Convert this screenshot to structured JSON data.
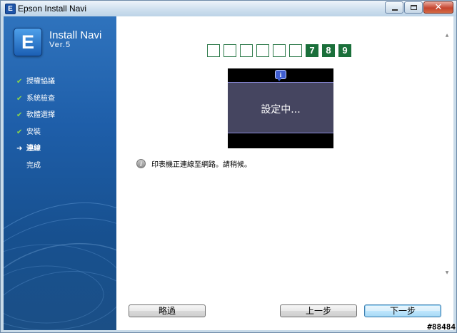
{
  "window": {
    "title": "Epson Install Navi",
    "close_glyph": "✕"
  },
  "sidebar": {
    "logo_letter": "E",
    "app_name": "Install Navi",
    "app_version": "Ver.5",
    "steps": [
      {
        "label": "授權協議",
        "state": "done",
        "marker": "✔"
      },
      {
        "label": "系統檢查",
        "state": "done",
        "marker": "✔"
      },
      {
        "label": "軟體選擇",
        "state": "done",
        "marker": "✔"
      },
      {
        "label": "安裝",
        "state": "done",
        "marker": "✔"
      },
      {
        "label": "連線",
        "state": "current",
        "marker": "➜"
      },
      {
        "label": "完成",
        "state": "pending",
        "marker": ""
      }
    ]
  },
  "progress": {
    "boxes": [
      {
        "label": "",
        "on": false
      },
      {
        "label": "",
        "on": false
      },
      {
        "label": "",
        "on": false
      },
      {
        "label": "",
        "on": false
      },
      {
        "label": "",
        "on": false
      },
      {
        "label": "",
        "on": false
      },
      {
        "label": "7",
        "on": true
      },
      {
        "label": "8",
        "on": true
      },
      {
        "label": "9",
        "on": true
      }
    ]
  },
  "lcd": {
    "info_glyph": "i",
    "text": "設定中..."
  },
  "status": {
    "icon_glyph": "i",
    "message": "印表機正連線至網路。請稍候。"
  },
  "buttons": {
    "skip": "略過",
    "back": "上一步",
    "next": "下一步"
  },
  "watermark": "#88484",
  "colors": {
    "progress_on": "#1a6f3a",
    "sidebar": "#1e5ea9",
    "lcd_screen": "#454560"
  }
}
